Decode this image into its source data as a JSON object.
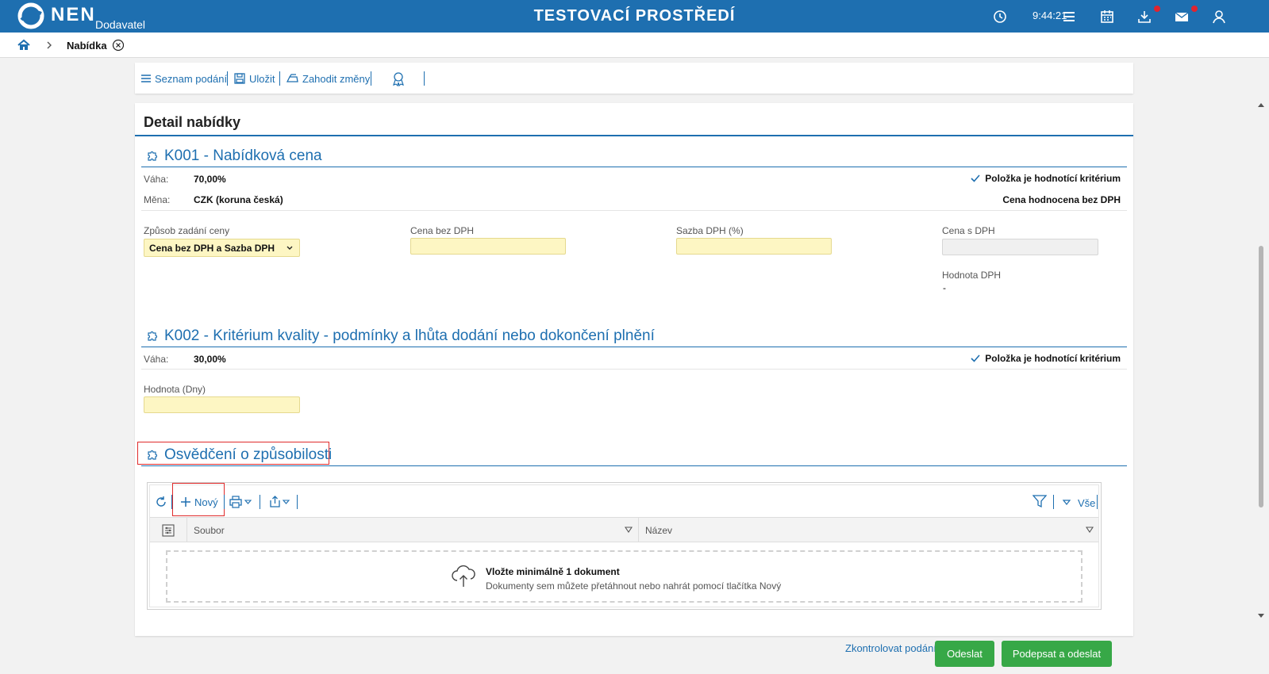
{
  "header": {
    "logo_text": "NEN",
    "logo_sub": "Dodavatel",
    "environment_title": "TESTOVACÍ PROSTŘEDÍ",
    "clock": "9:44:21"
  },
  "breadcrumb": {
    "current": "Nabídka"
  },
  "toolbar": {
    "list_label": "Seznam podání",
    "save_label": "Uložit",
    "discard_label": "Zahodit změny"
  },
  "card": {
    "title": "Detail nabídky"
  },
  "k001": {
    "title": "K001 - Nabídková cena",
    "weight_label": "Váha:",
    "weight_value": "70,00%",
    "currency_label": "Měna:",
    "currency_value": "CZK (koruna česká)",
    "criterion_note": "Položka je hodnotící kritérium",
    "evaluation_note": "Cena hodnocena bez DPH",
    "price_mode_label": "Způsob zadání ceny",
    "price_mode_value": "Cena bez DPH a Sazba DPH",
    "price_no_vat_label": "Cena bez DPH",
    "vat_rate_label": "Sazba DPH (%)",
    "price_with_vat_label": "Cena s DPH",
    "vat_value_label": "Hodnota DPH",
    "vat_value": "-"
  },
  "k002": {
    "title": "K002 - Kritérium kvality - podmínky a lhůta dodání nebo dokončení plnění",
    "weight_label": "Váha:",
    "weight_value": "30,00%",
    "criterion_note": "Položka je hodnotící kritérium",
    "value_label": "Hodnota (Dny)"
  },
  "certificate": {
    "title": "Osvědčení o způsobilosti",
    "new_label": "Nový",
    "filter_all_label": "Vše",
    "columns": [
      "Soubor",
      "Název"
    ],
    "empty_title": "Vložte minimálně 1 dokument",
    "empty_sub": "Dokumenty sem můžete přetáhnout nebo nahrát pomocí tlačítka Nový"
  },
  "footer": {
    "check_label": "Zkontrolovat podání",
    "send_label": "Odeslat",
    "sign_send_label": "Podepsat a odeslat"
  },
  "colors": {
    "brand": "#1e6fb0",
    "success": "#37a847",
    "required_field": "#fdf6c3",
    "highlight": "#e02b2b"
  }
}
